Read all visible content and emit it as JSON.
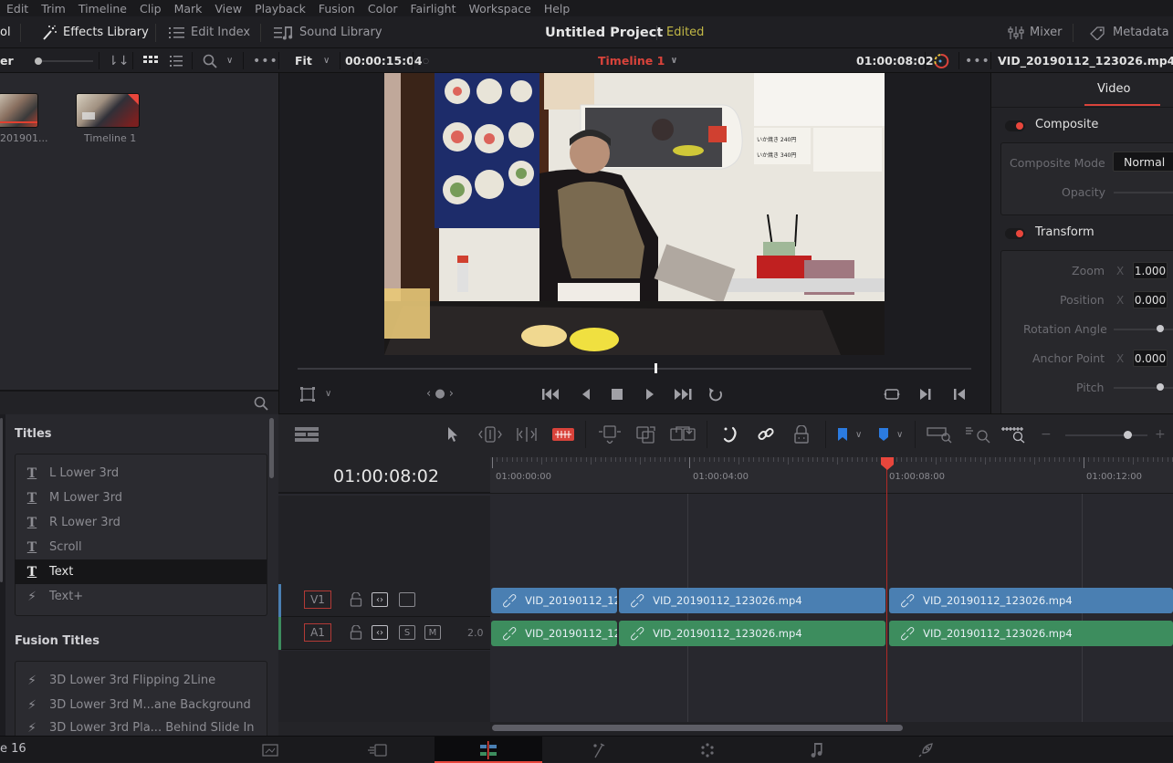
{
  "menubar": [
    "Edit",
    "Trim",
    "Timeline",
    "Clip",
    "Mark",
    "View",
    "Playback",
    "Fusion",
    "Color",
    "Fairlight",
    "Workspace",
    "Help"
  ],
  "topbar": {
    "media_pool_partial": "ol",
    "effects_library": "Effects Library",
    "edit_index": "Edit Index",
    "sound_library": "Sound Library",
    "project_title": "Untitled Project",
    "project_status": "Edited",
    "mixer": "Mixer",
    "metadata": "Metadata"
  },
  "subbar": {
    "master_partial": "er",
    "zoom_mode": "Fit",
    "source_duration": "00:00:15:04",
    "timeline_name": "Timeline 1",
    "timecode": "01:00:08:02",
    "clip_name": "VID_20190112_123026.mp4"
  },
  "media_pool": {
    "items": [
      {
        "name": "201901...",
        "type": "clip"
      },
      {
        "name": "Timeline 1",
        "type": "timeline"
      }
    ]
  },
  "effects": {
    "search_icon": "search-icon",
    "titles_header": "Titles",
    "titles": [
      {
        "label": "L Lower 3rd",
        "icon": "T",
        "selected": false
      },
      {
        "label": "M Lower 3rd",
        "icon": "T",
        "selected": false
      },
      {
        "label": "R Lower 3rd",
        "icon": "T",
        "selected": false
      },
      {
        "label": "Scroll",
        "icon": "T",
        "selected": false
      },
      {
        "label": "Text",
        "icon": "T",
        "selected": true
      },
      {
        "label": "Text+",
        "icon": "⚡",
        "selected": false
      }
    ],
    "fusion_header": "Fusion Titles",
    "fusion_titles": [
      {
        "label": "3D Lower 3rd Flipping 2Line"
      },
      {
        "label": "3D Lower 3rd M...ane Background"
      },
      {
        "label": "3D Lower 3rd Pla... Behind Slide In"
      }
    ]
  },
  "inspector": {
    "tab": "Video",
    "composite": {
      "title": "Composite",
      "mode_label": "Composite Mode",
      "mode_value": "Normal",
      "opacity_label": "Opacity"
    },
    "transform": {
      "title": "Transform",
      "zoom_label": "Zoom",
      "zoom_axis": "X",
      "zoom_value": "1.000",
      "position_label": "Position",
      "position_axis": "X",
      "position_value": "0.000",
      "rotation_label": "Rotation Angle",
      "anchor_label": "Anchor Point",
      "anchor_axis": "X",
      "anchor_value": "0.000",
      "pitch_label": "Pitch"
    }
  },
  "viewer": {
    "scrubber_position": 0.53
  },
  "timeline": {
    "timecode": "01:00:08:02",
    "ruler": [
      "01:00:00:00",
      "01:00:04:00",
      "01:00:08:00",
      "01:00:12:00"
    ],
    "playhead_timecode": "01:00:08:02",
    "zoom_level": 0.75,
    "tracks": [
      {
        "id": "V1",
        "type": "video",
        "clips": [
          "VID_20190112_123...",
          "VID_20190112_123026.mp4",
          "VID_20190112_123026.mp4"
        ]
      },
      {
        "id": "A1",
        "type": "audio",
        "channels": "2.0",
        "solo": "S",
        "mute": "M",
        "clips": [
          "VID_20190112_123...",
          "VID_20190112_123026.mp4",
          "VID_20190112_123026.mp4"
        ]
      }
    ],
    "scrollbar_range": [
      0,
      0.6
    ]
  },
  "pagebar": {
    "version_partial": "e 16",
    "pages": [
      "media",
      "cut",
      "edit",
      "fusion",
      "color",
      "fairlight",
      "deliver"
    ],
    "active_page": "edit"
  },
  "colors": {
    "accent_red": "#e8463c",
    "video_clip": "#4a7fb2",
    "audio_clip": "#3d8d5e",
    "status_yellow": "#c2b846"
  }
}
